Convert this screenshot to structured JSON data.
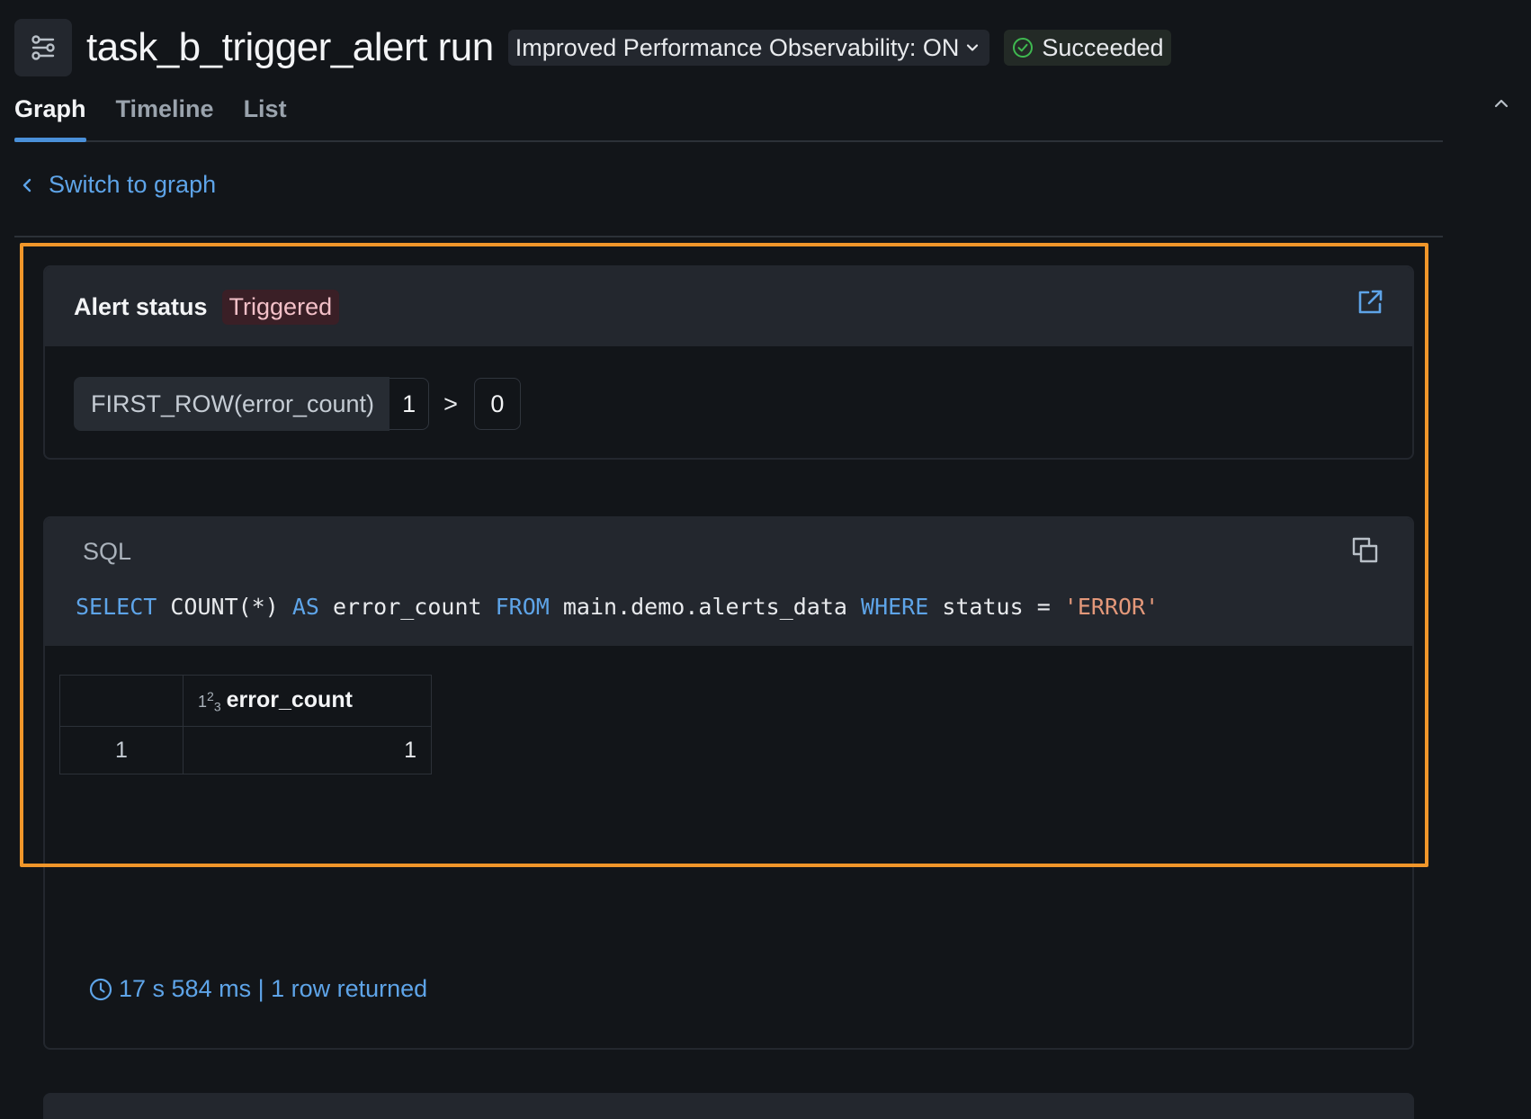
{
  "header": {
    "title": "task_b_trigger_alert run",
    "observability_label": "Improved Performance Observability: ON",
    "status_label": "Succeeded"
  },
  "tabs": [
    {
      "label": "Graph",
      "active": true
    },
    {
      "label": "Timeline",
      "active": false
    },
    {
      "label": "List",
      "active": false
    }
  ],
  "switch_link": "Switch to graph",
  "alert": {
    "title": "Alert status",
    "status": "Triggered",
    "condition": {
      "expression": "FIRST_ROW(error_count)",
      "value": "1",
      "operator": ">",
      "threshold": "0"
    }
  },
  "query": {
    "label": "SQL",
    "sql": {
      "kw_select": "SELECT",
      "t1": " COUNT(*) ",
      "kw_as": "AS",
      "t2": " error_count ",
      "kw_from": "FROM",
      "t3": " main.demo.alerts_data ",
      "kw_where": "WHERE",
      "t4": " status = ",
      "str": "'ERROR'"
    },
    "table": {
      "column_type": "123",
      "column": "error_count",
      "rows": [
        {
          "index": "1",
          "value": "1"
        }
      ]
    },
    "stats": "17 s 584 ms | 1 row returned"
  },
  "colors": {
    "accent": "#5ea4e8",
    "highlight": "#f0962a",
    "success": "#3fb950",
    "triggered_bg": "#3a1f26"
  },
  "icons": {
    "job": "workflow-icon",
    "chevron": "chevron-down-icon",
    "status": "check-circle-icon",
    "collapse": "chevron-up-icon",
    "back": "chevron-left-icon",
    "external": "external-link-icon",
    "copy": "copy-icon",
    "clock": "clock-icon"
  }
}
